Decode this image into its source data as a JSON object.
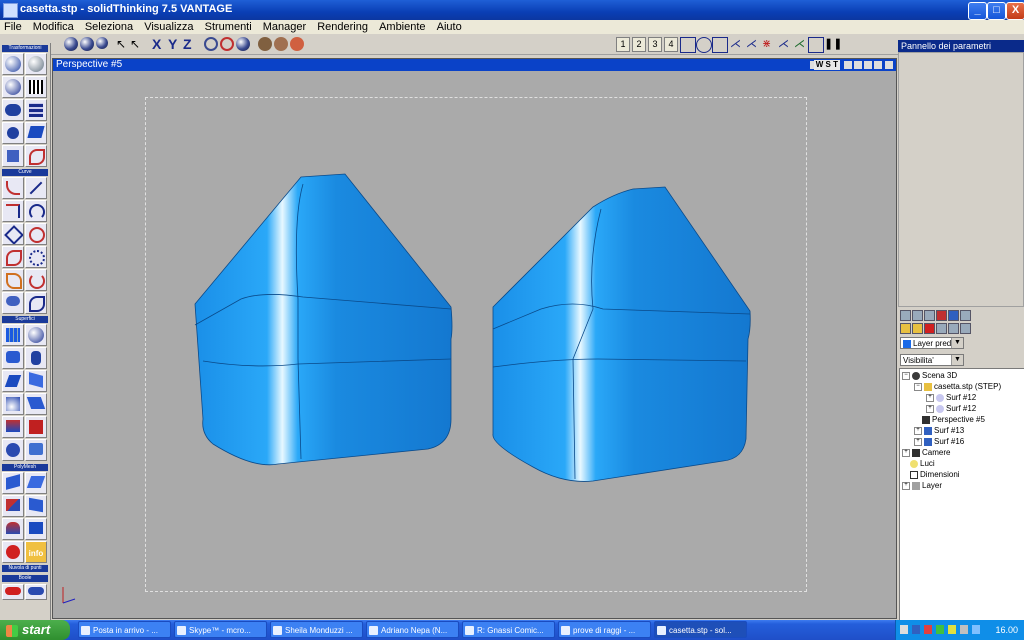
{
  "window": {
    "title": "casetta.stp - solidThinking 7.5  VANTAGE",
    "buttons": [
      "_",
      "□",
      "X"
    ]
  },
  "menu": [
    "File",
    "Modifica",
    "Seleziona",
    "Visualizza",
    "Strumenti",
    "Manager",
    "Rendering",
    "Ambiente",
    "Aiuto"
  ],
  "toolbar": {
    "axis_labels": [
      "X",
      "Y",
      "Z"
    ],
    "view_numbers": [
      "1",
      "2",
      "3",
      "4"
    ]
  },
  "left_toolbar": {
    "sections": [
      "Trasformazioni",
      "Curve",
      "Superfici",
      "PolyMesh",
      "Nuvola di punti",
      "Boole"
    ],
    "info_label": "info"
  },
  "viewport": {
    "title": "Perspective #5",
    "wst_label": "W S T"
  },
  "params_panel": {
    "title": "Pannello dei parametri"
  },
  "layer_combo": "Layer pred",
  "visibility_combo": "Visibilita'",
  "tree": {
    "scene": "Scena 3D",
    "file": "casetta.stp (STEP)",
    "surf12a": "Surf #12",
    "surf12b": "Surf #12",
    "perspective": "Perspective #5",
    "surf13": "Surf #13",
    "surf16": "Surf #16",
    "camere": "Camere",
    "luci": "Luci",
    "dimensioni": "Dimensioni",
    "layer": "Layer"
  },
  "taskbar": {
    "start": "start",
    "tasks": [
      "Posta in arrivo - ...",
      "Skype™ - mcro...",
      "Sheila Monduzzi ...",
      "Adriano Nepa (N...",
      "R: Gnassi Comic...",
      "prove di raggi - ...",
      "casetta.stp - sol..."
    ],
    "clock": "16.00"
  },
  "colors": {
    "object_blue": "#1a8fe8",
    "viewport_gray": "#aaaaaa",
    "title_blue": "#0a42c8"
  }
}
